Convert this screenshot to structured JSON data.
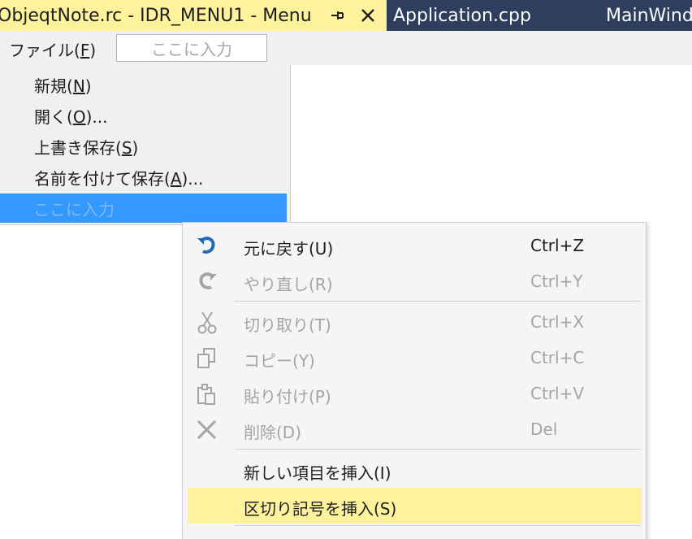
{
  "tabs": {
    "active_title": "ObjeqtNote.rc - IDR_MENU1 - Menu",
    "second": "Application.cpp",
    "third": "MainWind"
  },
  "menubar": {
    "file_label": "ファイル(",
    "file_key": "F",
    "file_close": ")",
    "type_here": "ここに入力"
  },
  "dropdown": {
    "items": [
      {
        "pre": "新規(",
        "key": "N",
        "post": ")"
      },
      {
        "pre": "開く(",
        "key": "O",
        "post": ")..."
      },
      {
        "pre": "上書き保存(",
        "key": "S",
        "post": ")"
      },
      {
        "pre": "名前を付けて保存(",
        "key": "A",
        "post": ")..."
      }
    ],
    "type_here": "ここに入力"
  },
  "context_menu": {
    "items": [
      {
        "label": "元に戻す(U)",
        "shortcut": "Ctrl+Z",
        "icon": "undo-icon",
        "enabled": true
      },
      {
        "label": "やり直し(R)",
        "shortcut": "Ctrl+Y",
        "icon": "redo-icon",
        "enabled": false
      },
      {
        "label": "切り取り(T)",
        "shortcut": "Ctrl+X",
        "icon": "cut-icon",
        "enabled": false
      },
      {
        "label": "コピー(Y)",
        "shortcut": "Ctrl+C",
        "icon": "copy-icon",
        "enabled": false
      },
      {
        "label": "貼り付け(P)",
        "shortcut": "Ctrl+V",
        "icon": "paste-icon",
        "enabled": false
      },
      {
        "label": "削除(D)",
        "shortcut": "Del",
        "icon": "delete-icon",
        "enabled": false
      },
      {
        "label": "新しい項目を挿入(I)",
        "shortcut": "",
        "enabled": true
      },
      {
        "label": "区切り記号を挿入(S)",
        "shortcut": "",
        "enabled": true,
        "highlighted": true
      }
    ]
  },
  "colors": {
    "active_tab": "#fff29d",
    "tab_strip": "#2d3e5e",
    "selection": "#3399ff",
    "undo_icon": "#1e69b8",
    "disabled": "#a2a4a5"
  }
}
